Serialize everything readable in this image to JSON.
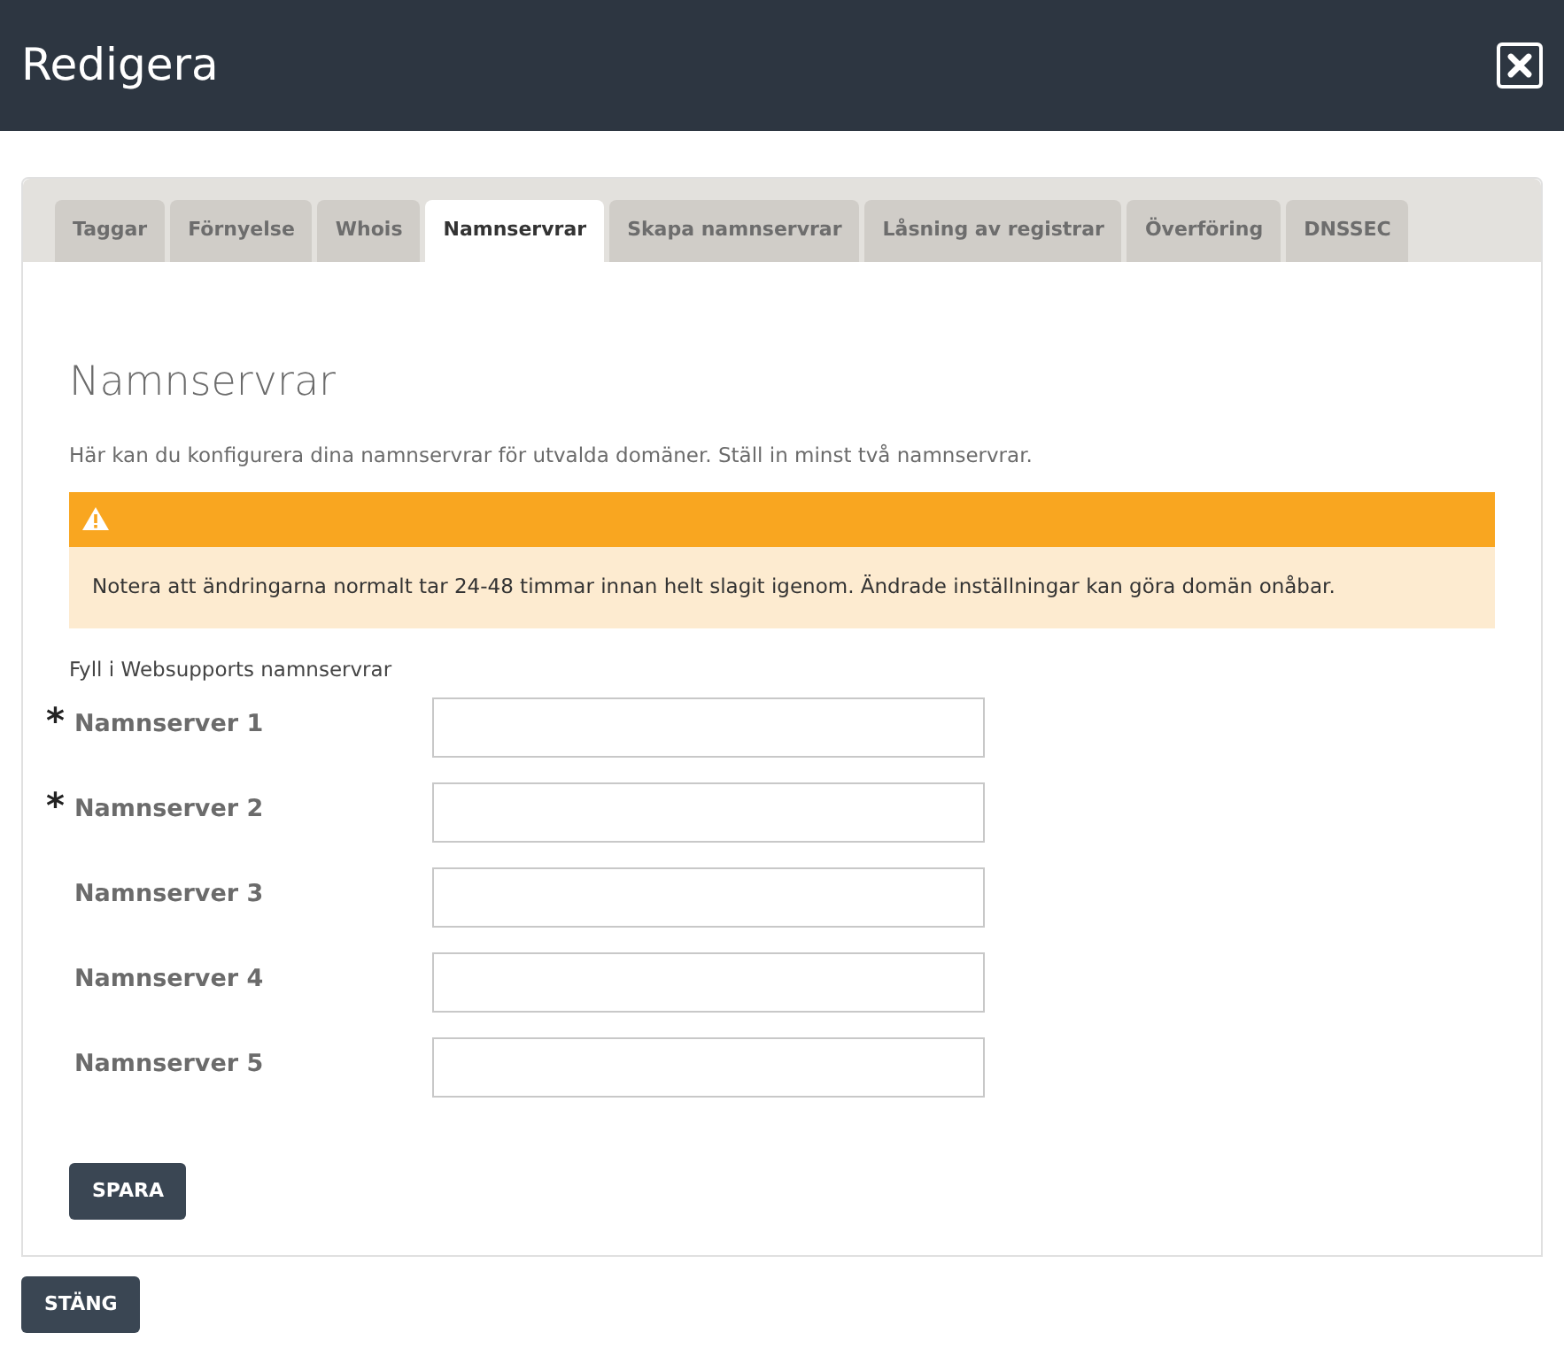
{
  "window": {
    "title": "Redigera"
  },
  "tabs": [
    {
      "label": "Taggar",
      "selected": false
    },
    {
      "label": "Förnyelse",
      "selected": false
    },
    {
      "label": "Whois",
      "selected": false
    },
    {
      "label": "Namnservrar",
      "selected": true
    },
    {
      "label": "Skapa namnservrar",
      "selected": false
    },
    {
      "label": "Låsning av registrar",
      "selected": false
    },
    {
      "label": "Överföring",
      "selected": false
    },
    {
      "label": "DNSSEC",
      "selected": false
    }
  ],
  "heading": "Namnservrar",
  "description": "Här kan du konfigurera dina namnservrar för utvalda domäner. Ställ in minst två namnservrar.",
  "warning": {
    "text": "Notera att ändringarna normalt tar 24-48 timmar innan helt slagit igenom. Ändrade inställningar kan göra domän onåbar."
  },
  "form_caption": "Fyll i Websupports namnservrar",
  "fields": [
    {
      "label": "Namnserver 1",
      "required_mark": "*"
    },
    {
      "label": "Namnserver 2",
      "required_mark": "*"
    },
    {
      "label": "Namnserver 3"
    },
    {
      "label": "Namnserver 4"
    },
    {
      "label": "Namnserver 5"
    }
  ],
  "save_button": "SPARA",
  "close_button": "STÄNG"
}
